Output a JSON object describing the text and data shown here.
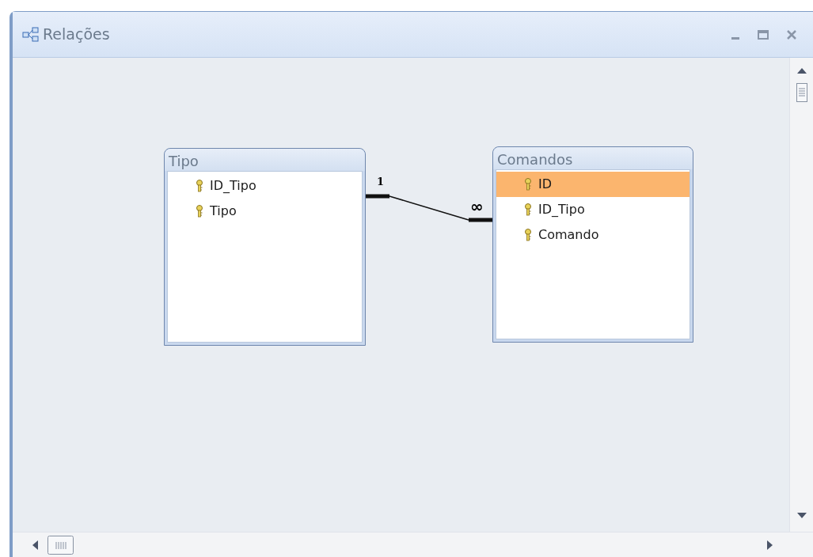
{
  "window": {
    "title": "Relações"
  },
  "tables": [
    {
      "name": "Tipo",
      "fields": [
        {
          "name": "ID_Tipo",
          "selected": false
        },
        {
          "name": "Tipo",
          "selected": false
        }
      ]
    },
    {
      "name": "Comandos",
      "fields": [
        {
          "name": "ID",
          "selected": true
        },
        {
          "name": "ID_Tipo",
          "selected": false
        },
        {
          "name": "Comando",
          "selected": false
        }
      ]
    }
  ],
  "relationship": {
    "one_label": "1",
    "many_label": "∞"
  }
}
